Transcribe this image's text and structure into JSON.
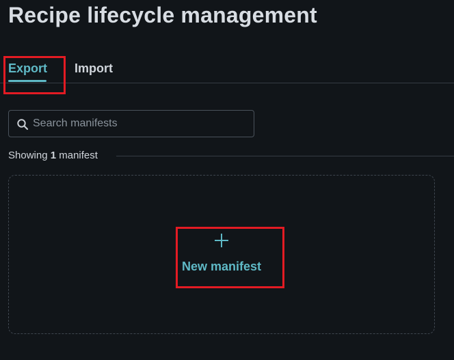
{
  "page": {
    "title": "Recipe lifecycle management"
  },
  "tabs": [
    {
      "label": "Export",
      "active": true
    },
    {
      "label": "Import",
      "active": false
    }
  ],
  "search": {
    "placeholder": "Search manifests",
    "value": "",
    "icon": "search-icon"
  },
  "summary": {
    "prefix": "Showing",
    "count": "1",
    "unit": "manifest"
  },
  "new_manifest": {
    "icon": "plus-icon",
    "label": "New manifest"
  },
  "colors": {
    "background": "#111519",
    "accent": "#5fb9c6",
    "highlight": "#e31b23",
    "text": "#d5dae0"
  }
}
